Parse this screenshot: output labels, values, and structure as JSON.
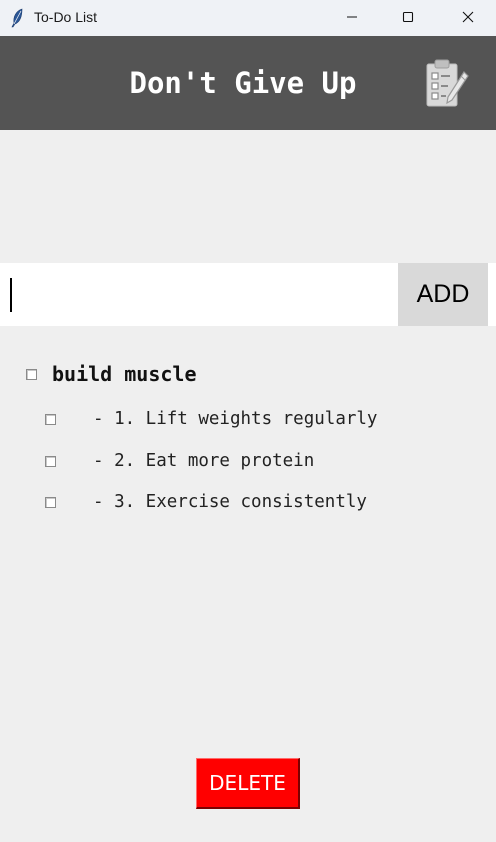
{
  "window": {
    "title": "To-Do List",
    "icon": "feather-icon",
    "controls": [
      "minimize-icon",
      "maximize-icon",
      "close-icon"
    ]
  },
  "header": {
    "title": "Don't Give Up",
    "icon": "clipboard-checklist-icon",
    "background": "#545454"
  },
  "input": {
    "value": "",
    "placeholder": ""
  },
  "add_button": {
    "label": "ADD",
    "background": "#d9d9d9"
  },
  "tasks": [
    {
      "label": "build muscle",
      "checked": false,
      "subtasks": [
        {
          "label": "- 1. Lift weights regularly",
          "checked": false
        },
        {
          "label": "- 2. Eat more protein",
          "checked": false
        },
        {
          "label": "- 3. Exercise consistently",
          "checked": false
        }
      ]
    }
  ],
  "delete_button": {
    "label": "DELETE",
    "background": "#ff0000"
  }
}
